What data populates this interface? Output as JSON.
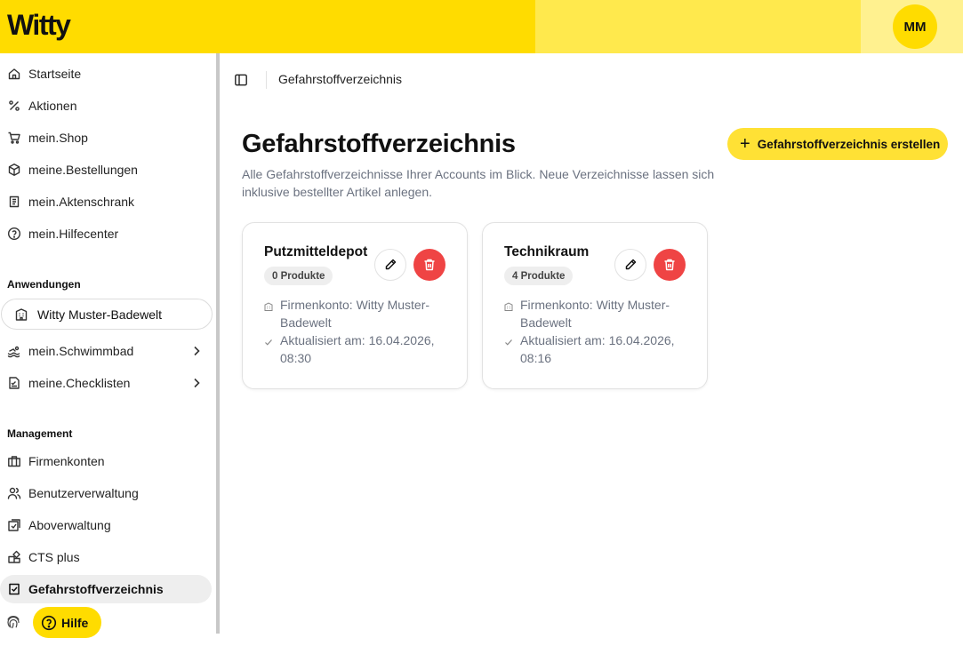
{
  "header": {
    "logo": "Witty",
    "avatar_initials": "MM",
    "colors": {
      "primary": "#FFDC00",
      "mid": "#FFE94D",
      "light": "#FFF18F"
    }
  },
  "sidebar": {
    "items": [
      {
        "label": "Startseite",
        "icon": "home-icon"
      },
      {
        "label": "Aktionen",
        "icon": "percent-icon"
      },
      {
        "label": "mein.Shop",
        "icon": "cart-icon"
      },
      {
        "label": "meine.Bestellungen",
        "icon": "package-icon"
      },
      {
        "label": "mein.Aktenschrank",
        "icon": "file-cabinet-icon"
      },
      {
        "label": "mein.Hilfecenter",
        "icon": "help-circle-icon"
      }
    ],
    "applications_heading": "Anwendungen",
    "account_selector": "Witty Muster-Badewelt",
    "app_items": [
      {
        "label": "mein.Schwimmbad",
        "icon": "swimmer-icon"
      },
      {
        "label": "meine.Checklisten",
        "icon": "checklist-icon"
      }
    ],
    "management_heading": "Management",
    "management_items": [
      {
        "label": "Firmenkonten",
        "icon": "briefcase-icon"
      },
      {
        "label": "Benutzerverwaltung",
        "icon": "users-icon"
      },
      {
        "label": "Aboverwaltung",
        "icon": "subscription-icon"
      },
      {
        "label": "CTS plus",
        "icon": "blocks-icon"
      },
      {
        "label": "Gefahrstoffverzeichnis",
        "icon": "clipboard-check-icon",
        "active": true
      }
    ],
    "help_label": "Hilfe"
  },
  "breadcrumb": {
    "current": "Gefahrstoffverzeichnis"
  },
  "main": {
    "title": "Gefahrstoffverzeichnis",
    "description": "Alle Gefahrstoffverzeichnisse Ihrer Accounts im Blick. Neue Verzeichnisse lassen sich inklusive bestellter Artikel anlegen.",
    "create_button": "Gefahrstoffverzeichnis erstellen",
    "cards": [
      {
        "name": "Putzmitteldepot",
        "products": "0 Produkte",
        "account": "Firmenkonto: Witty Muster-Badewelt",
        "updated": "Aktualisiert am: 16.04.2026, 08:30"
      },
      {
        "name": "Technikraum",
        "products": "4 Produkte",
        "account": "Firmenkonto: Witty Muster-Badewelt",
        "updated": "Aktualisiert am: 16.04.2026, 08:16"
      }
    ],
    "colors": {
      "danger": "#EF4444",
      "accent": "#FFE135"
    }
  }
}
